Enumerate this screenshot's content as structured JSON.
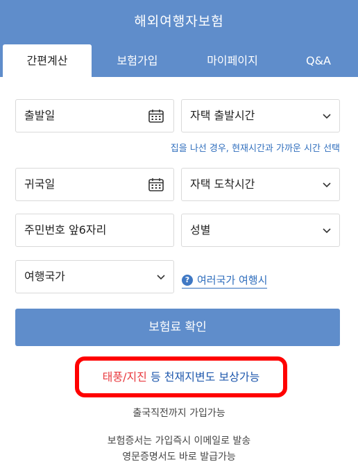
{
  "header": {
    "title": "해외여행자보험"
  },
  "tabs": [
    {
      "label": "간편계산",
      "active": true
    },
    {
      "label": "보험가입",
      "active": false
    },
    {
      "label": "마이페이지",
      "active": false
    },
    {
      "label": "Q&A",
      "active": false
    }
  ],
  "form": {
    "departure_date": "출발일",
    "departure_time": "자택 출발시간",
    "time_hint": "집을 나선 경우, 현재시간과 가까운 시간 선택",
    "return_date": "귀국일",
    "arrival_time": "자택 도착시간",
    "id_number": "주민번호 앞6자리",
    "gender": "성별",
    "country": "여행국가",
    "multi_country_link": "여러국가 여행시",
    "help_icon": "?"
  },
  "confirm_button": "보험료 확인",
  "promo": {
    "red_text": "태풍/지진",
    "blue_text": " 등 천재지변도 보상가능"
  },
  "info": {
    "line1": "출국직전까지 가입가능",
    "line2": "보험증서는 가입즉시 이메일로 발송",
    "line3": "영문증명서도 바로 발급가능"
  },
  "colors": {
    "brand": "#5f8dcb",
    "link": "#2f6ebd",
    "highlight_border": "#ff0000",
    "promo_red": "#e8383d"
  }
}
